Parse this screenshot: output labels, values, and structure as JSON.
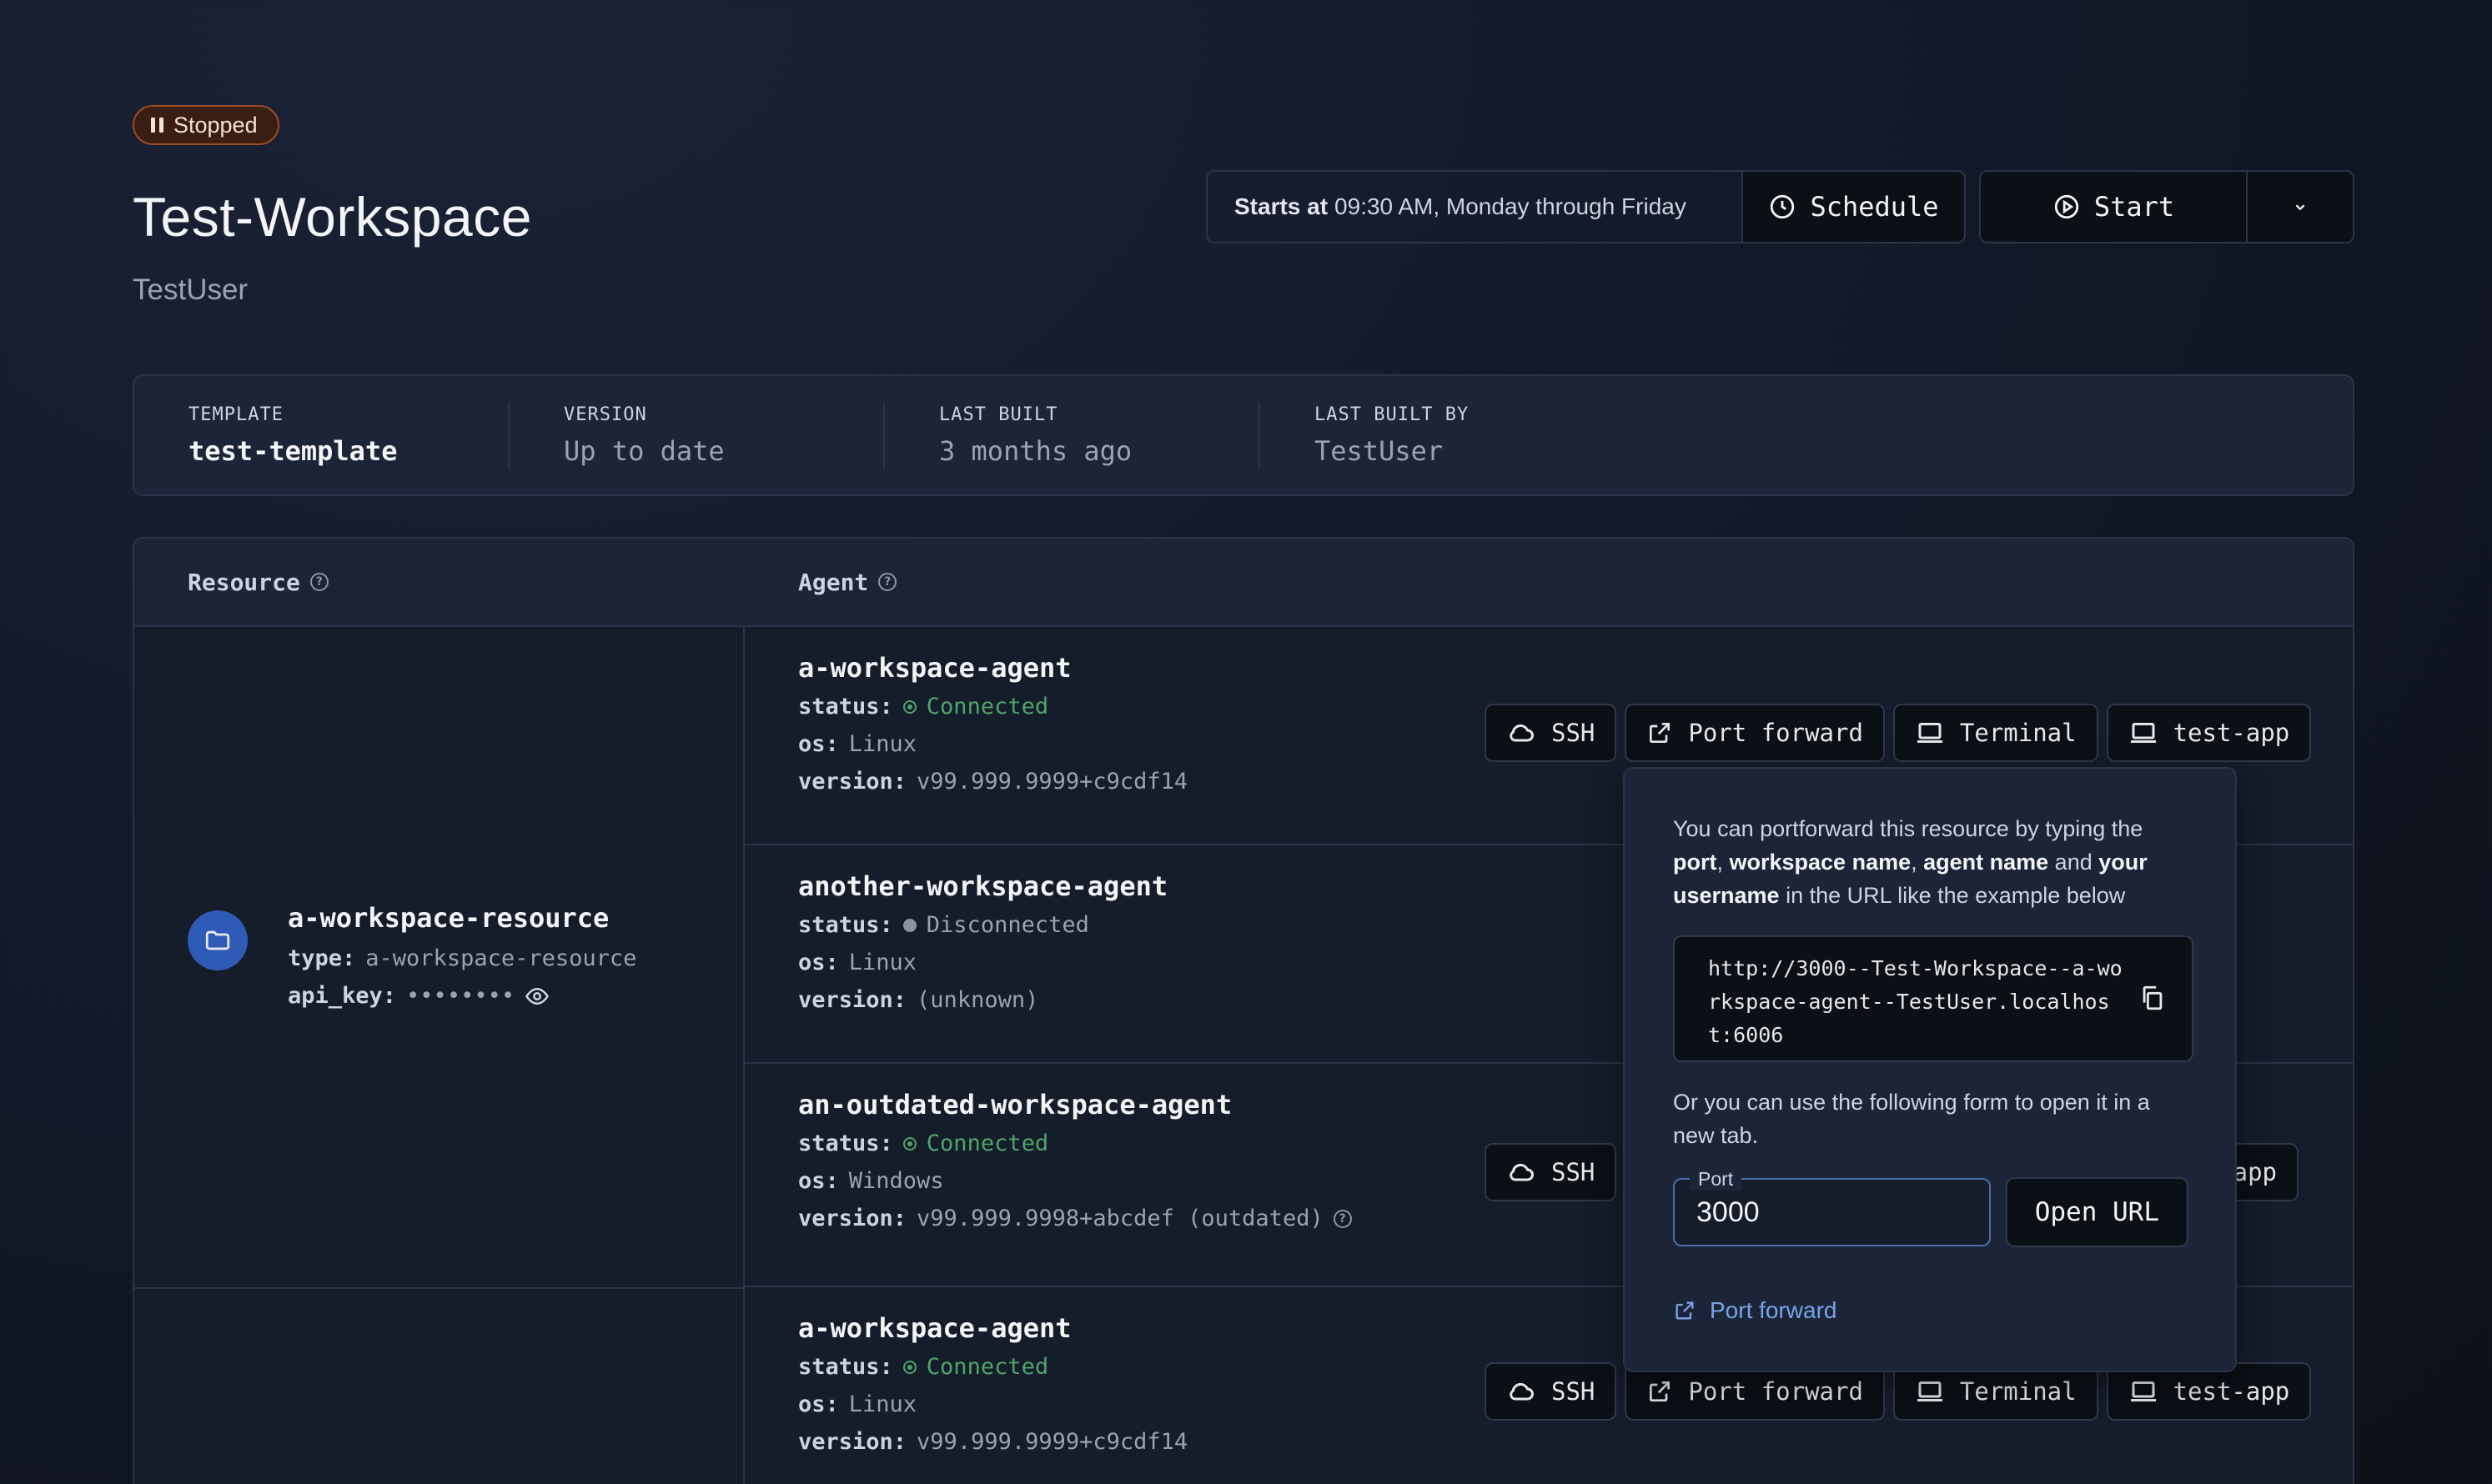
{
  "workspace": {
    "status": "Stopped",
    "name": "Test-Workspace",
    "owner": "TestUser"
  },
  "schedule": {
    "prefix": "Starts at",
    "text": "09:30 AM, Monday through Friday",
    "button_label": "Schedule"
  },
  "start": {
    "button_label": "Start"
  },
  "info": [
    {
      "label": "TEMPLATE",
      "value": "test-template"
    },
    {
      "label": "VERSION",
      "value": "Up to date"
    },
    {
      "label": "LAST BUILT",
      "value": "3 months ago"
    },
    {
      "label": "LAST BUILT BY",
      "value": "TestUser"
    }
  ],
  "table": {
    "col_resource": "Resource",
    "col_agent": "Agent",
    "help_glyph": "?"
  },
  "resource": {
    "name": "a-workspace-resource",
    "type_label": "type:",
    "type_value": "a-workspace-resource",
    "api_key_label": "api_key:",
    "api_key_value": "••••••••"
  },
  "labels": {
    "status": "status:",
    "os": "os:",
    "version": "version:"
  },
  "agents": [
    {
      "name": "a-workspace-agent",
      "status": "Connected",
      "os": "Linux",
      "version": "v99.999.9999+c9cdf14"
    },
    {
      "name": "another-workspace-agent",
      "status": "Disconnected",
      "os": "Linux",
      "version": "(unknown)"
    },
    {
      "name": "an-outdated-workspace-agent",
      "status": "Connected",
      "os": "Windows",
      "version": "v99.999.9998+abcdef (outdated)"
    },
    {
      "name": "a-workspace-agent",
      "status": "Connected",
      "os": "Linux",
      "version": "v99.999.9999+c9cdf14"
    }
  ],
  "actions": {
    "ssh": "SSH",
    "port_forward": "Port forward",
    "terminal": "Terminal",
    "app": "test-app",
    "app_partial": "app"
  },
  "popover": {
    "t1": "You can portforward this resource by typing the ",
    "b1": "port",
    "t2": ", ",
    "b2": "workspace name",
    "t3": ", ",
    "b3": "agent name",
    "t4": " and ",
    "b4": "your username",
    "t5": " in the URL like the example below",
    "example_url": "http://3000--Test-Workspace--a-workspace-agent--TestUser.localhost:6006",
    "form_hint": "Or you can use the following form to open it in a new tab.",
    "port_label": "Port",
    "port_value": "3000",
    "open_url": "Open URL",
    "link_label": "Port forward"
  }
}
